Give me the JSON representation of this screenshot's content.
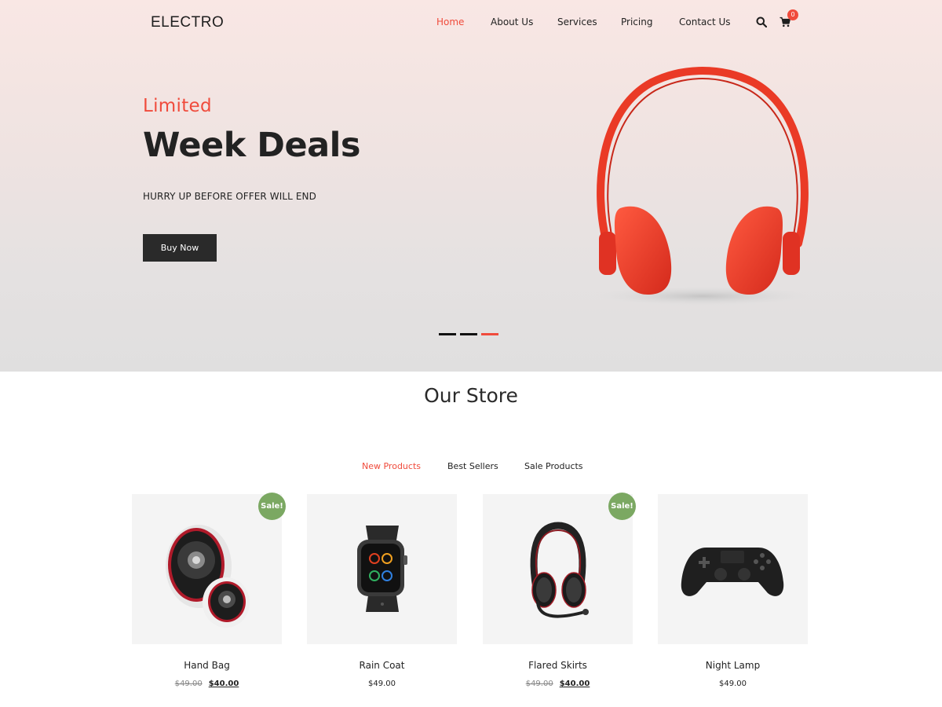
{
  "nav": {
    "logo": "ELECTRO",
    "items": [
      {
        "label": "Home",
        "active": true
      },
      {
        "label": "About Us",
        "active": false
      },
      {
        "label": "Services",
        "active": false
      },
      {
        "label": "Pricing",
        "active": false
      },
      {
        "label": "Contact Us",
        "active": false
      }
    ],
    "search_icon": "search-icon",
    "cart_icon": "cart-icon",
    "cart_count": "0"
  },
  "hero": {
    "subtitle": "Limited",
    "title": "Week Deals",
    "description": "HURRY UP BEFORE OFFER WILL END",
    "button_label": "Buy Now",
    "image": "red-headphones",
    "slides": 3,
    "active_slide": 3
  },
  "store": {
    "title": "Our Store",
    "tabs": [
      {
        "label": "New Products",
        "active": true
      },
      {
        "label": "Best Sellers",
        "active": false
      },
      {
        "label": "Sale Products",
        "active": false
      }
    ],
    "products": [
      {
        "name": "Hand Bag",
        "image": "speakers",
        "sale": true,
        "sale_label": "Sale!",
        "old_price": "$49.00",
        "price": "$40.00"
      },
      {
        "name": "Rain Coat",
        "image": "smartwatch",
        "sale": false,
        "price": "$49.00"
      },
      {
        "name": "Flared Skirts",
        "image": "gaming-headset",
        "sale": true,
        "sale_label": "Sale!",
        "old_price": "$49.00",
        "price": "$40.00"
      },
      {
        "name": "Night Lamp",
        "image": "game-controller",
        "sale": false,
        "price": "$49.00"
      }
    ]
  },
  "colors": {
    "accent": "#f04b3c",
    "dark": "#2a2a2a",
    "sale": "#7ba862",
    "card_bg": "#f4f4f4"
  }
}
